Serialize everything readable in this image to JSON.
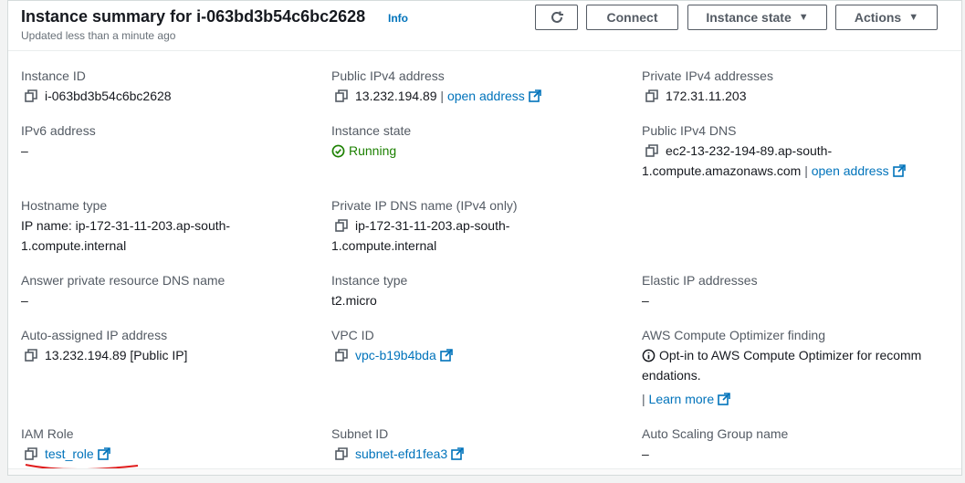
{
  "header": {
    "title": "Instance summary for i-063bd3b54c6bc2628",
    "info_label": "Info",
    "subtitle": "Updated less than a minute ago",
    "connect_label": "Connect",
    "instance_state_label": "Instance state",
    "actions_label": "Actions"
  },
  "fields": {
    "instance_id": {
      "label": "Instance ID",
      "value": "i-063bd3b54c6bc2628"
    },
    "public_ipv4": {
      "label": "Public IPv4 address",
      "value": "13.232.194.89",
      "link": "open address"
    },
    "private_ipv4": {
      "label": "Private IPv4 addresses",
      "value": "172.31.11.203"
    },
    "ipv6": {
      "label": "IPv6 address",
      "value": "–"
    },
    "instance_state": {
      "label": "Instance state",
      "value": "Running"
    },
    "public_dns": {
      "label": "Public IPv4 DNS",
      "value_line1": "ec2-13-232-194-89.ap-south-",
      "value_line2": "1.compute.amazonaws.com",
      "link": "open address"
    },
    "hostname_type": {
      "label": "Hostname type",
      "value_line1": "IP name: ip-172-31-11-203.ap-south-",
      "value_line2": "1.compute.internal"
    },
    "private_dns": {
      "label": "Private IP DNS name (IPv4 only)",
      "value_line1": "ip-172-31-11-203.ap-south-",
      "value_line2": "1.compute.internal"
    },
    "answer_dns": {
      "label": "Answer private resource DNS name",
      "value": "–"
    },
    "instance_type": {
      "label": "Instance type",
      "value": "t2.micro"
    },
    "elastic_ip": {
      "label": "Elastic IP addresses",
      "value": "–"
    },
    "auto_ip": {
      "label": "Auto-assigned IP address",
      "value": "13.232.194.89 [Public IP]"
    },
    "vpc_id": {
      "label": "VPC ID",
      "value": "vpc-b19b4bda"
    },
    "optimizer": {
      "label": "AWS Compute Optimizer finding",
      "value_line1": "Opt-in to AWS Compute Optimizer for recomm",
      "value_line2": "endations.",
      "link": "Learn more"
    },
    "iam_role": {
      "label": "IAM Role",
      "value": "test_role"
    },
    "subnet_id": {
      "label": "Subnet ID",
      "value": "subnet-efd1fea3"
    },
    "asg_name": {
      "label": "Auto Scaling Group name",
      "value": "–"
    }
  },
  "colors": {
    "link": "#0073bb",
    "running": "#1d8102",
    "annotation": "#e01b1b"
  },
  "icons": [
    "refresh-icon",
    "copy-icon",
    "external-link-icon",
    "check-circle-icon",
    "info-circle-icon",
    "caret-down-icon"
  ]
}
